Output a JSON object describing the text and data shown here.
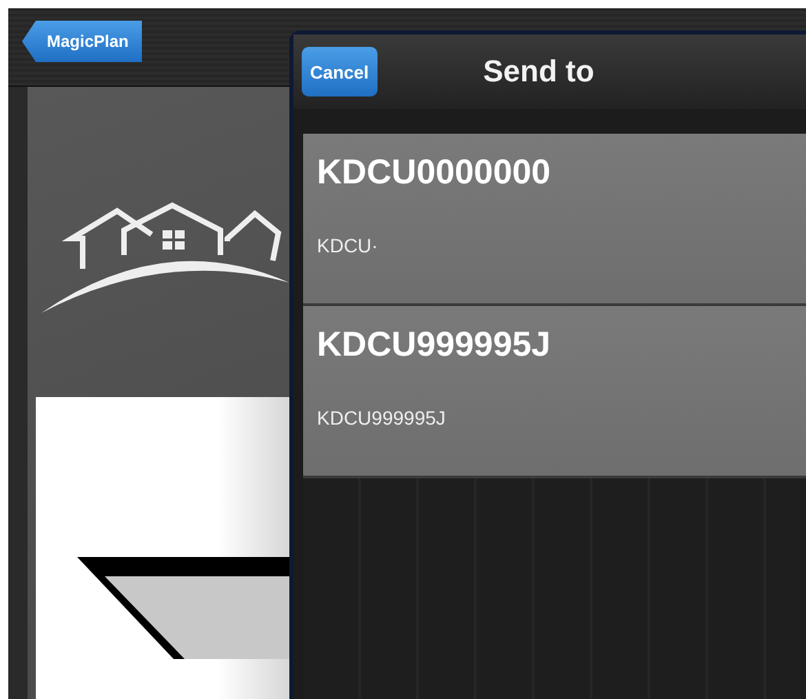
{
  "nav_bar": {
    "back_button": "MagicPlan"
  },
  "popover": {
    "title": "Send to",
    "cancel_button": "Cancel",
    "items": [
      {
        "title": "KDCU0000000",
        "subtitle": "KDCU·"
      },
      {
        "title": "KDCU999995J",
        "subtitle": "KDCU999995J"
      }
    ]
  }
}
